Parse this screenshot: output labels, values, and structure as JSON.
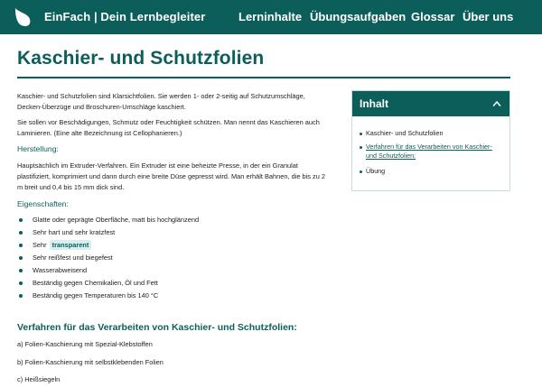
{
  "header": {
    "brand": "EinFach | Dein Lernbegleiter",
    "nav": [
      "Lerninhalte",
      "Übungsaufgaben",
      "Glossar",
      "Über uns"
    ]
  },
  "page": {
    "title": "Kaschier- und Schutzfolien",
    "intro_1": [
      "Kaschier- und Schutzfolien sind Klarsichtfolien. Sie werden 1- oder 2-seitig auf Schutzumschläge,",
      "Decken-Überzüge und Broschuren-Umschläge kaschiert."
    ],
    "intro_2": [
      "Sie sollen vor Beschädigungen, Schmutz oder Feuchtigkeit schützen. Man nennt das Kaschieren auch",
      "Laminieren. (Eine alte Bezeichnung ist Cellophanieren.)"
    ],
    "herstellung_heading": "Herstellung:",
    "herstellung_text": [
      "Hauptsächlich im Extruder-Verfahren. Ein Extruder ist eine beheizte Presse, in der ein Granulat",
      "plastifiziert, komprimiert und dann durch eine breite Düse gepresst wird. Man erhält Bahnen, die bis zu 2",
      "m breit und 0,4 bis 15 mm dick sind."
    ],
    "eigenschaften_heading": "Eigenschaften:",
    "eigenschaften": [
      "Glatte oder geprägte Oberfläche, matt bis hochglänzend",
      "Sehr hart und sehr kratzfest",
      "Sehr",
      "Sehr reißfest und biegefest",
      "Wasserabweisend",
      "Beständig gegen Chemikalien, Öl und Fett",
      "Beständig gegen Temperaturen bis 140 °C"
    ],
    "badge": "transparent",
    "verfahren_heading": "Verfahren für das Verarbeiten von Kaschier- und Schutzfolien:",
    "verfahren": [
      "a) Folien-Kaschierung mit Spezial-Klebstoffen",
      "b) Folien-Kaschierung mit selbstklebenden Folien",
      "c) Heißsiegeln"
    ]
  },
  "toc": {
    "title": "Inhalt",
    "items": [
      "Kaschier- und Schutzfolien",
      "Verfahren für das Verarbeiten von Kaschier-",
      "und Schutzfolien:",
      "Übung"
    ]
  },
  "colors": {
    "primary": "#0c5e5a",
    "badge_bg": "#d9efee"
  },
  "icons": {
    "logo": "leaf-logo-icon",
    "toc_toggle": "chevron-up-icon"
  }
}
